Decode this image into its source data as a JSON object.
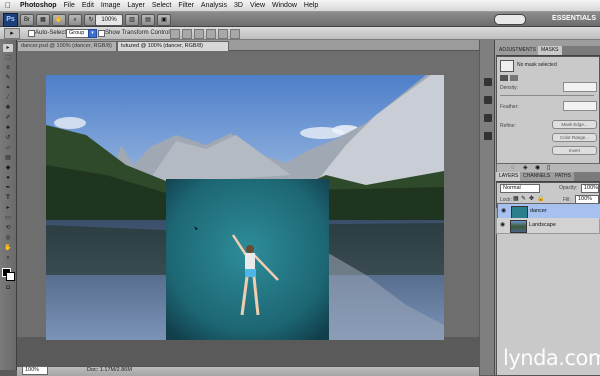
{
  "menubar": {
    "items": [
      "Photoshop",
      "File",
      "Edit",
      "Image",
      "Layer",
      "Select",
      "Filter",
      "Analysis",
      "3D",
      "View",
      "Window",
      "Help"
    ]
  },
  "appbar": {
    "zoom": "100%",
    "workspace": "ESSENTIALS"
  },
  "options": {
    "auto_select_label": "Auto-Select:",
    "auto_select_value": "Group",
    "transform_label": "Show Transform Controls"
  },
  "tabs": [
    {
      "label": "dancer.psd @ 100% (dancer, RGB/8)",
      "active": false
    },
    {
      "label": "tutuzed @ 100% (dancer, RGB/8)",
      "active": true
    }
  ],
  "status": {
    "zoom": "100%",
    "doc": "Doc: 1.17M/2.86M"
  },
  "adjustments": {
    "tabs": [
      "ADJUSTMENTS",
      "MASKS"
    ],
    "header": "No mask selected",
    "density_label": "Density:",
    "feather_label": "Feather:",
    "refine_label": "Refine:",
    "buttons": [
      "Mask Edge...",
      "Color Range...",
      "Invert"
    ]
  },
  "layers": {
    "tabs": [
      "LAYERS",
      "CHANNELS",
      "PATHS"
    ],
    "blend_mode": "Normal",
    "opacity_label": "Opacity:",
    "opacity_value": "100%",
    "lock_label": "Lock:",
    "fill_label": "Fill:",
    "fill_value": "100%",
    "items": [
      {
        "name": "dancer",
        "selected": true
      },
      {
        "name": "Landscape",
        "selected": false
      }
    ]
  },
  "watermark": "lynda.com",
  "colors": {
    "selection_blue": "#a6c0ef",
    "app_bar": "#7d7d7d",
    "workspace": "#6e6e6e"
  }
}
